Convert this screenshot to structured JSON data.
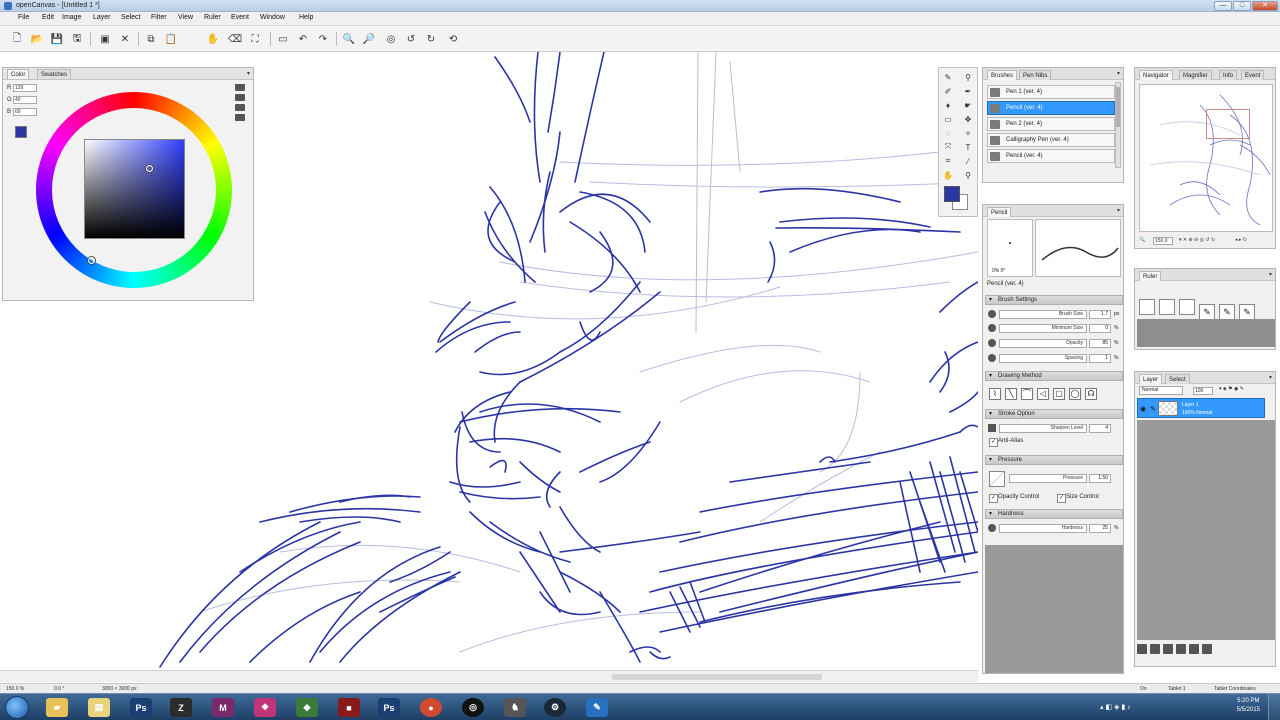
{
  "window": {
    "title": "openCanvas - [Untitled 1 *]",
    "controls": [
      "—",
      "□",
      "✕"
    ]
  },
  "menu": [
    "File",
    "Edit",
    "Image",
    "Layer",
    "Select",
    "Filter",
    "View",
    "Ruler",
    "Event",
    "Window",
    "Help"
  ],
  "color_panel": {
    "tabs": [
      "Color",
      "Swatches"
    ],
    "rgb": [
      {
        "label": "R",
        "value": "129"
      },
      {
        "label": "G",
        "value": "40"
      },
      {
        "label": "B",
        "value": "69"
      }
    ],
    "current_color": "#2b35a5"
  },
  "brushes_panel": {
    "tabs": [
      "Brushes",
      "Pen Nibs"
    ],
    "items": [
      {
        "label": "Pen 1 (ver. 4)",
        "selected": false
      },
      {
        "label": "Pencil (ver. 4)",
        "selected": true
      },
      {
        "label": "Pen 2 (ver. 4)",
        "selected": false
      },
      {
        "label": "Calligraphy Pen (ver. 4)",
        "selected": false
      },
      {
        "label": "Pencil (ver. 4)",
        "selected": false
      }
    ]
  },
  "pencil_panel": {
    "tab": "Pencil",
    "preview_info": "0%   0°",
    "preset_name": "Pencil (ver. 4)",
    "sections": {
      "brush_settings": "Brush Settings",
      "drawing_method": "Drawing Method",
      "stroke_option": "Stroke Option",
      "pressure": "Pressure",
      "hardness": "Hardness"
    },
    "sliders": {
      "brush_size": {
        "label": "Brush Size",
        "value": "1.7",
        "unit": "px",
        "fill": 0.1
      },
      "minimum_size": {
        "label": "Minimum Size",
        "value": "0",
        "unit": "%",
        "fill": 0.0
      },
      "opacity": {
        "label": "Opacity",
        "value": "85",
        "unit": "%",
        "fill": 0.85
      },
      "spacing": {
        "label": "Spacing",
        "value": "1",
        "unit": "%",
        "fill": 0.02
      },
      "sharpen_level": {
        "label": "Sharpen Level",
        "value": "4",
        "unit": ""
      },
      "pressure": {
        "label": "Pressure",
        "value": "1.50",
        "unit": "",
        "fill": 0.5
      },
      "hardness": {
        "label": "Hardness",
        "value": "25",
        "unit": "%",
        "fill": 0.25
      }
    },
    "checkboxes": {
      "anti_alias": "Anti-Alias",
      "opacity_control": "Opacity Control",
      "size_control": "Size Control"
    }
  },
  "navigator_panel": {
    "tabs": [
      "Navigator",
      "Magnifier",
      "Info",
      "Event"
    ],
    "zoom": "150.0"
  },
  "ruler_panel": {
    "tab": "Ruler"
  },
  "layer_panel": {
    "tabs": [
      "Layer",
      "Select"
    ],
    "blend_mode": "Normal",
    "opacity": "100",
    "layers": [
      {
        "name": "Layer 1",
        "meta": "100% Normal"
      }
    ]
  },
  "status": {
    "zoom": "150.0 %",
    "angle": "0.0 °",
    "canvas_size": "3000 × 3000 px",
    "on": "On",
    "tablet": "Tablet 1",
    "tablet_coords": "Tablet Coordinates"
  },
  "taskbar": {
    "time": "5:20 PM",
    "date": "5/5/2015"
  },
  "colors": {
    "accent": "#3399ff",
    "stroke": "#2b35a5"
  }
}
